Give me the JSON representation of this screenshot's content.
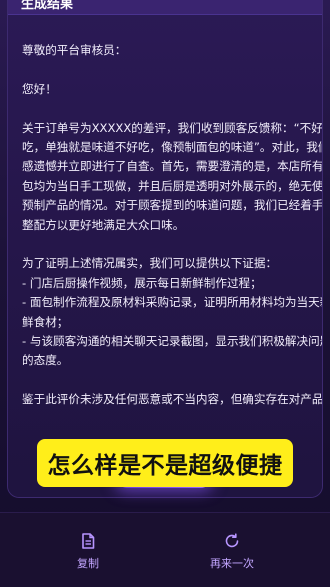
{
  "card": {
    "title": "生成结果"
  },
  "letter": {
    "greeting": "尊敬的平台审核员：",
    "hello": "您好！",
    "para1": [
      "关于订单号为XXXXX的差评，我们收到顾客反馈称：“不好",
      "吃，单独就是味道不好吃，像预制面包的味道”。对此，我们",
      "感遗憾并立即进行了自查。首先，需要澄清的是，本店所有面",
      "包均为当日手工现做，并且后厨是透明对外展示的，绝无使用",
      "预制产品的情况。对于顾客提到的味道问题，我们已经着手调",
      "整配方以更好地满足大众口味。"
    ],
    "para2": [
      "为了证明上述情况属实，我们可以提供以下证据：",
      "- 门店后厨操作视频，展示每日新鲜制作过程；",
      "- 面包制作流程及原材料采购记录，证明所用材料均为当天新",
      "鲜食材；",
      "- 与该顾客沟通的相关聊天记录截图，显示我们积极解决问题",
      "的态度。"
    ],
    "para3": [
      "鉴于此评价未涉及任何恶意或不当内容，但确实存在对产品质"
    ]
  },
  "caption": "怎么样是不是超级便捷",
  "actions": {
    "copy_label": "复制",
    "regenerate_label": "再来一次"
  },
  "colors": {
    "accent": "#b795ff",
    "caption_bg": "#ffee1a",
    "card_bg": "#25164a"
  },
  "icons": {
    "copy": "document-icon",
    "regenerate": "refresh-icon"
  }
}
